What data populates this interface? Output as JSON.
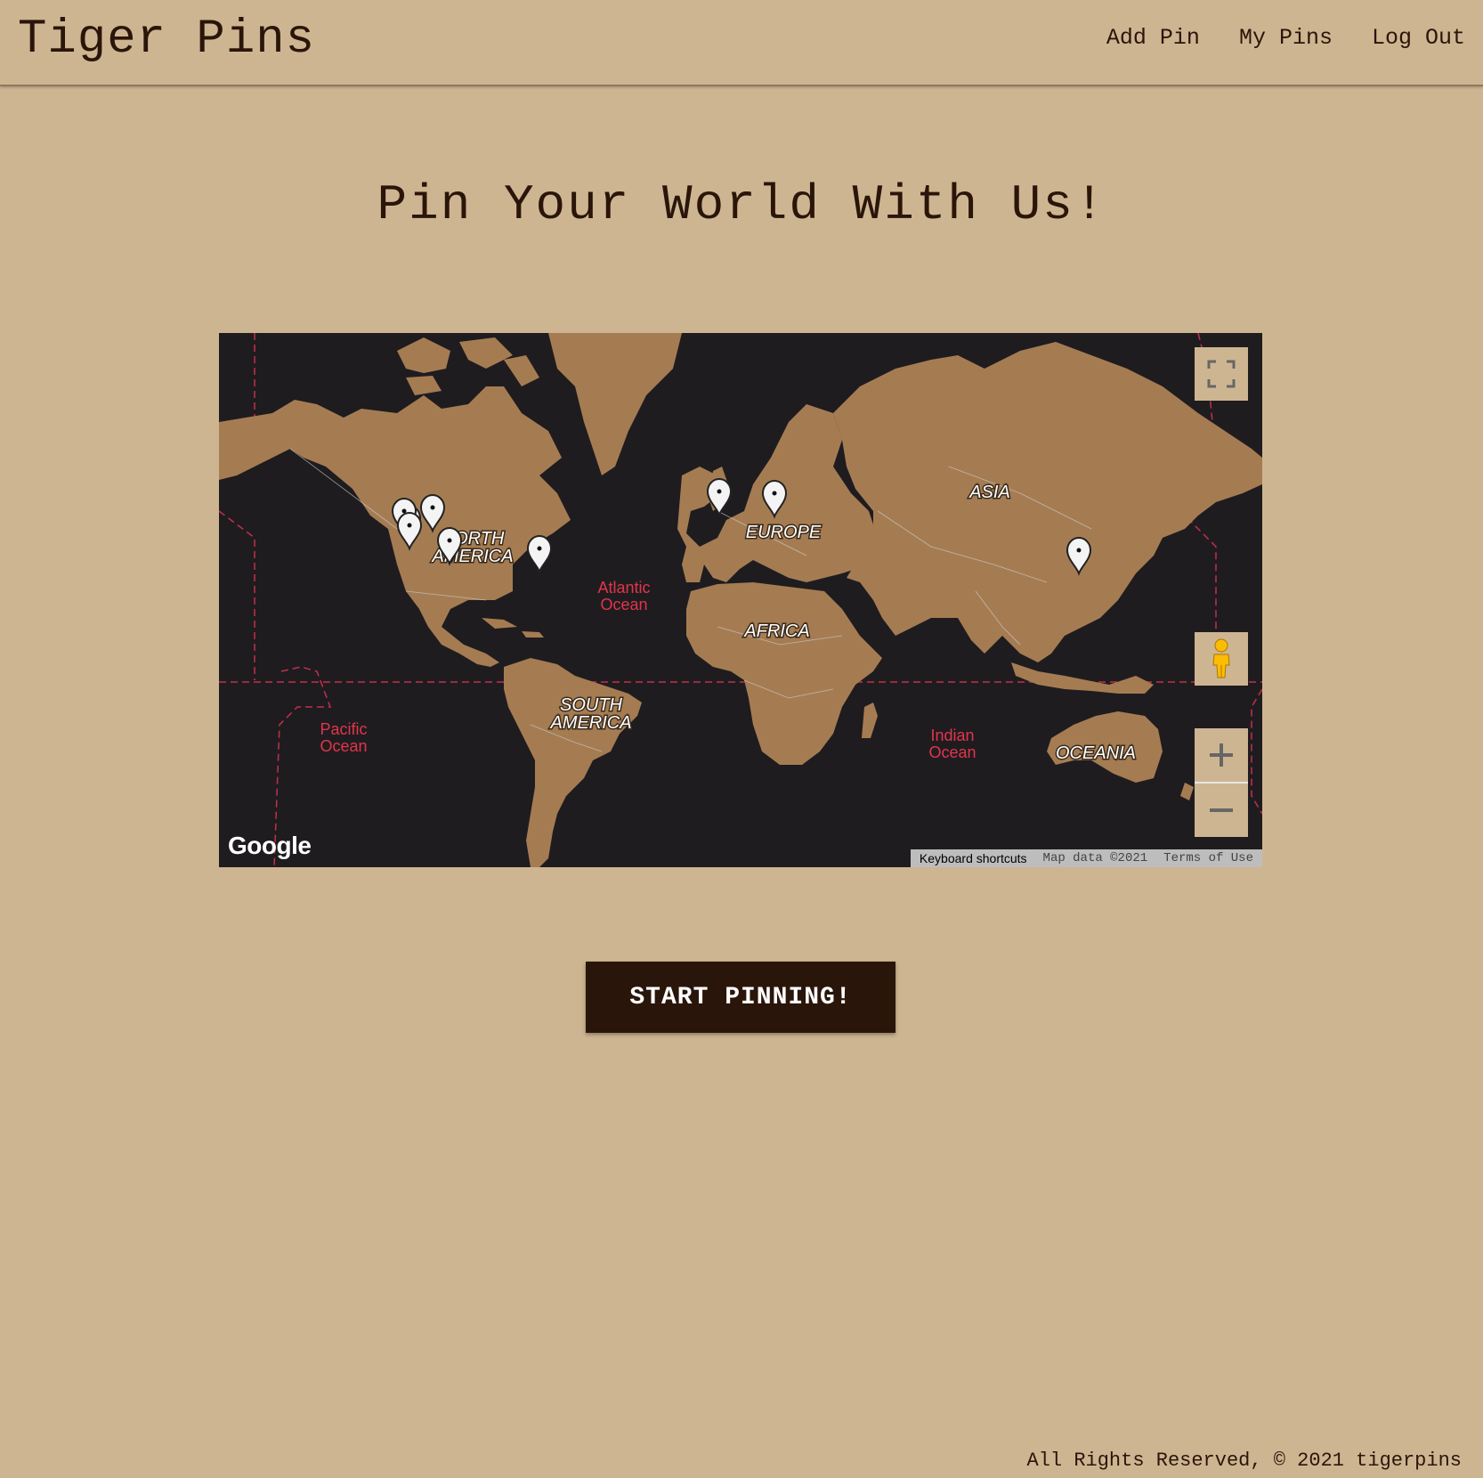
{
  "header": {
    "brand": "Tiger Pins",
    "nav": [
      {
        "label": "Add Pin"
      },
      {
        "label": "My Pins"
      },
      {
        "label": "Log Out"
      }
    ]
  },
  "main": {
    "headline": "Pin Your World With Us!",
    "cta_label": "START PINNING!"
  },
  "map": {
    "continents": {
      "north_america_1": "NORTH",
      "north_america_2": "AMERICA",
      "south_america_1": "SOUTH",
      "south_america_2": "AMERICA",
      "europe": "EUROPE",
      "africa": "AFRICA",
      "asia": "ASIA",
      "oceania": "OCEANIA"
    },
    "oceans": {
      "atlantic_1": "Atlantic",
      "atlantic_2": "Ocean",
      "pacific_1": "Pacific",
      "pacific_2": "Ocean",
      "indian_1": "Indian",
      "indian_2": "Ocean"
    },
    "logo": "Google",
    "attribution": {
      "shortcuts": "Keyboard shortcuts",
      "map_data": "Map data ©2021",
      "terms": "Terms of Use"
    },
    "colors": {
      "land": "#a57c52",
      "water": "#1f1c20",
      "boundary": "#d0cfcf",
      "ocean_label": "#e0364a",
      "dateline": "#c0304a"
    },
    "pin_count": 9
  },
  "footer": {
    "text": "All Rights Reserved, © 2021 tigerpins"
  },
  "colors": {
    "background": "#ceb591",
    "primary": "#2a150a",
    "button_text": "#ffffff"
  }
}
